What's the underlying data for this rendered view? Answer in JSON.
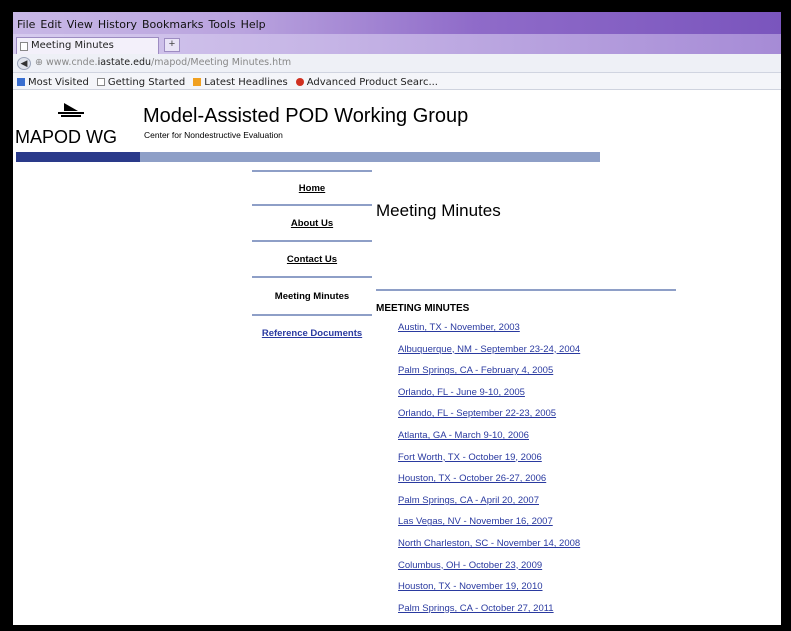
{
  "browser": {
    "menu": [
      "File",
      "Edit",
      "View",
      "History",
      "Bookmarks",
      "Tools",
      "Help"
    ],
    "tab_title": "Meeting Minutes",
    "new_tab": "+",
    "url_prefix": "www.cnde.",
    "url_domain": "iastate.edu",
    "url_path": "/mapod/Meeting Minutes.htm",
    "bookmarks": [
      {
        "label": "Most Visited",
        "icon": "bookmark-star-icon",
        "color": "#3a6fd0"
      },
      {
        "label": "Getting Started",
        "icon": "page-icon",
        "color": "#ffffff"
      },
      {
        "label": "Latest Headlines",
        "icon": "rss-icon",
        "color": "#f0a020"
      },
      {
        "label": "Advanced Product Searc...",
        "icon": "search-icon",
        "color": "#d03020"
      }
    ]
  },
  "site": {
    "brand": "MAPOD WG",
    "title": "Model-Assisted POD Working Group",
    "subtitle": "Center for Nondestructive Evaluation",
    "colors": {
      "dark_band": "#2a3a8a",
      "light_band": "#8e9fc7",
      "link": "#2a3aa0"
    }
  },
  "nav": {
    "home": "Home",
    "about": "About Us",
    "contact": "Contact Us",
    "current": "Meeting Minutes",
    "reference": "Reference Documents"
  },
  "main": {
    "heading": "Meeting Minutes",
    "section": "MEETING MINUTES",
    "minutes": [
      "Austin, TX - November, 2003",
      "Albuquerque, NM - September 23-24, 2004",
      "Palm Springs, CA - February 4, 2005",
      "Orlando, FL - June 9-10, 2005",
      "Orlando, FL - September 22-23, 2005",
      "Atlanta, GA - March 9-10, 2006",
      "Fort Worth, TX - October 19, 2006",
      "Houston, TX - October 26-27, 2006",
      "Palm Springs, CA - April 20, 2007",
      "Las Vegas, NV - November 16, 2007",
      "North Charleston, SC - November 14, 2008",
      "Columbus, OH - October 23, 2009",
      "Houston, TX - November 19, 2010",
      "Palm Springs, CA - October 27, 2011"
    ]
  }
}
